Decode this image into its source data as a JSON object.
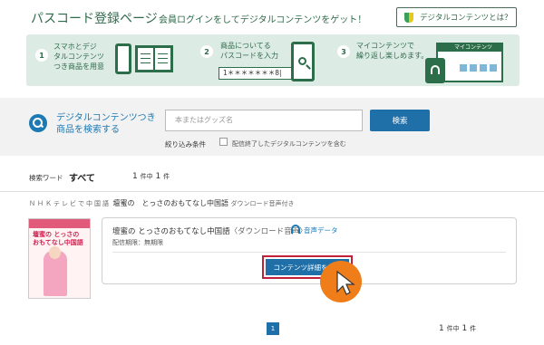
{
  "header": {
    "title": "パスコード登録ページ",
    "subtitle": "会員ログインをしてデジタルコンテンツをゲット！",
    "what_button": "デジタルコンテンツとは？"
  },
  "steps": [
    {
      "num": "1",
      "text": "スマホとデジ\nタルコンテンツ\nつき商品を用意"
    },
    {
      "num": "2",
      "text": "商品についてる\nパスコードを入力",
      "code": "1＊＊＊＊＊＊＊8|"
    },
    {
      "num": "3",
      "text": "マイコンテンツで\n繰り返し楽しめます。",
      "monitor_label": "マイコンテンツ"
    }
  ],
  "search": {
    "label": "デジタルコンテンツつき\n商品を検索する",
    "placeholder": "本またはグッズ名",
    "button": "検索",
    "filter_label": "絞り込み条件",
    "filter_option": "配信終了したデジタルコンテンツを含む"
  },
  "results": {
    "keyword_label": "検索ワード",
    "keyword_value": "すべて",
    "count_top": {
      "a": "1",
      "mid": "件中",
      "b": "1",
      "end": "件"
    },
    "count_bottom": {
      "a": "1",
      "mid": "件中",
      "b": "1",
      "end": "件"
    }
  },
  "product": {
    "publisher": "ＮＨＫテレビで中国語",
    "title": "壇蜜の　とっさのおもてなし中国語",
    "title_suffix": "ダウンロード音声付き",
    "cover_text": "壇蜜の とっさの\nおもてなし中国語",
    "card_title": "壇蜜の とっさのおもてなし中国語",
    "card_paren": "〈ダウンロード音声〉",
    "audio_label": "音声データ",
    "term": "配信期限：無期限",
    "detail_button": "コンテンツ詳細を見る"
  },
  "pagination": {
    "current": "1"
  },
  "colors": {
    "accent_green": "#2f6b4a",
    "accent_blue": "#1f6fa8",
    "highlight_red": "#c2203a",
    "cursor_orange": "#ef7d1a"
  }
}
